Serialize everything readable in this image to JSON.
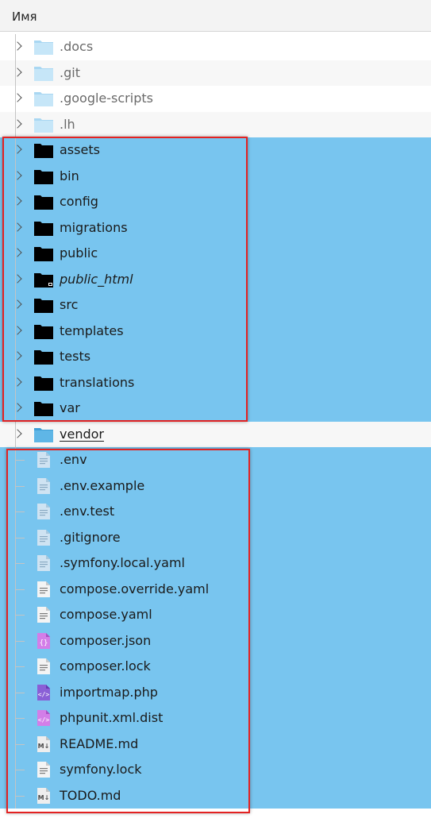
{
  "header": {
    "column_name": "Имя"
  },
  "items": [
    {
      "name": ".docs",
      "kind": "folder",
      "icon": "folder-light-icon",
      "dim": true,
      "expandable": true,
      "selected": false
    },
    {
      "name": ".git",
      "kind": "folder",
      "icon": "folder-light-icon",
      "dim": true,
      "expandable": true,
      "selected": false
    },
    {
      "name": ".google-scripts",
      "kind": "folder",
      "icon": "folder-light-icon",
      "dim": true,
      "expandable": true,
      "selected": false
    },
    {
      "name": ".lh",
      "kind": "folder",
      "icon": "folder-light-icon",
      "dim": true,
      "expandable": true,
      "selected": false
    },
    {
      "name": "assets",
      "kind": "folder",
      "icon": "folder-black-icon",
      "expandable": true,
      "selected": true
    },
    {
      "name": "bin",
      "kind": "folder",
      "icon": "folder-black-icon",
      "expandable": true,
      "selected": true
    },
    {
      "name": "config",
      "kind": "folder",
      "icon": "folder-black-icon",
      "expandable": true,
      "selected": true
    },
    {
      "name": "migrations",
      "kind": "folder",
      "icon": "folder-black-icon",
      "expandable": true,
      "selected": true
    },
    {
      "name": "public",
      "kind": "folder",
      "icon": "folder-black-icon",
      "expandable": true,
      "selected": true
    },
    {
      "name": "public_html",
      "kind": "folder",
      "icon": "folder-link-icon",
      "italic": true,
      "expandable": true,
      "selected": true
    },
    {
      "name": "src",
      "kind": "folder",
      "icon": "folder-black-icon",
      "expandable": true,
      "selected": true
    },
    {
      "name": "templates",
      "kind": "folder",
      "icon": "folder-black-icon",
      "expandable": true,
      "selected": true
    },
    {
      "name": "tests",
      "kind": "folder",
      "icon": "folder-black-icon",
      "expandable": true,
      "selected": true
    },
    {
      "name": "translations",
      "kind": "folder",
      "icon": "folder-black-icon",
      "expandable": true,
      "selected": true
    },
    {
      "name": "var",
      "kind": "folder",
      "icon": "folder-black-icon",
      "expandable": true,
      "selected": true
    },
    {
      "name": "vendor",
      "kind": "folder",
      "icon": "folder-blue-icon",
      "underline": true,
      "expandable": true,
      "selected": false
    },
    {
      "name": ".env",
      "kind": "file",
      "icon": "text-file-light-icon",
      "selected": true
    },
    {
      "name": ".env.example",
      "kind": "file",
      "icon": "text-file-light-icon",
      "selected": true
    },
    {
      "name": ".env.test",
      "kind": "file",
      "icon": "text-file-light-icon",
      "selected": true
    },
    {
      "name": ".gitignore",
      "kind": "file",
      "icon": "text-file-light-icon",
      "selected": true
    },
    {
      "name": ".symfony.local.yaml",
      "kind": "file",
      "icon": "text-file-light-icon",
      "selected": true
    },
    {
      "name": "compose.override.yaml",
      "kind": "file",
      "icon": "text-file-icon",
      "selected": true
    },
    {
      "name": "compose.yaml",
      "kind": "file",
      "icon": "text-file-icon",
      "selected": true
    },
    {
      "name": "composer.json",
      "kind": "file",
      "icon": "json-file-icon",
      "selected": true
    },
    {
      "name": "composer.lock",
      "kind": "file",
      "icon": "text-file-icon",
      "selected": true
    },
    {
      "name": "importmap.php",
      "kind": "file",
      "icon": "php-file-icon",
      "selected": true
    },
    {
      "name": "phpunit.xml.dist",
      "kind": "file",
      "icon": "xml-file-icon",
      "selected": true
    },
    {
      "name": "README.md",
      "kind": "file",
      "icon": "markdown-file-icon",
      "selected": true
    },
    {
      "name": "symfony.lock",
      "kind": "file",
      "icon": "text-file-icon",
      "selected": true
    },
    {
      "name": "TODO.md",
      "kind": "file",
      "icon": "markdown-file-icon",
      "selected": true
    }
  ],
  "colors": {
    "selection": "#78c5ef",
    "annotation_box": "#e32222",
    "folder_light": "#c6e6f8",
    "folder_blue": "#5fb6e6",
    "folder_black": "#000000"
  }
}
